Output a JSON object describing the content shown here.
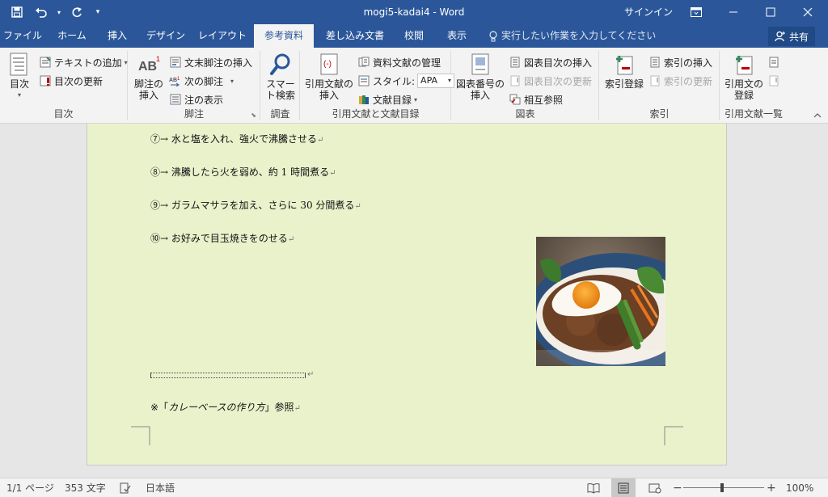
{
  "titlebar": {
    "title": "mogi5-kadai4  -  Word",
    "signin": "サインイン",
    "qat": {
      "save_icon": "save-icon",
      "undo_icon": "undo-icon",
      "redo_icon": "redo-icon",
      "customize": "▾"
    }
  },
  "tabs": [
    {
      "label": "ファイル"
    },
    {
      "label": "ホーム"
    },
    {
      "label": "挿入"
    },
    {
      "label": "デザイン"
    },
    {
      "label": "レイアウト"
    },
    {
      "label": "参考資料",
      "active": true
    },
    {
      "label": "差し込み文書"
    },
    {
      "label": "校閲"
    },
    {
      "label": "表示"
    }
  ],
  "tellme": "実行したい作業を入力してください",
  "share": "共有",
  "ribbon": {
    "toc": {
      "group_label": "目次",
      "toc_button": "目次",
      "add_text": "テキストの追加",
      "update_toc": "目次の更新"
    },
    "footnotes": {
      "group_label": "脚注",
      "insert_footnote_l1": "脚注の",
      "insert_footnote_l2": "挿入",
      "insert_endnote": "文末脚注の挿入",
      "next_footnote": "次の脚注",
      "show_notes": "注の表示"
    },
    "research": {
      "group_label": "調査",
      "smart_lookup_l1": "スマー",
      "smart_lookup_l2": "ト検索"
    },
    "citations": {
      "group_label": "引用文献と文献目録",
      "insert_citation_l1": "引用文献の",
      "insert_citation_l2": "挿入",
      "manage_sources": "資料文献の管理",
      "style_label": "スタイル:",
      "style_value": "APA",
      "bibliography": "文献目録"
    },
    "captions": {
      "group_label": "図表",
      "insert_caption_l1": "図表番号の",
      "insert_caption_l2": "挿入",
      "insert_table_of_figures": "図表目次の挿入",
      "update_table": "図表目次の更新",
      "cross_reference": "相互参照"
    },
    "index": {
      "group_label": "索引",
      "mark_entry": "索引登録",
      "insert_index": "索引の挿入",
      "update_index": "索引の更新"
    },
    "table_of_authorities": {
      "group_label": "引用文献一覧",
      "mark_citation_l1": "引用文の",
      "mark_citation_l2": "登録"
    }
  },
  "document": {
    "lines": [
      {
        "text": "⑦→ 水と塩を入れ、強火で沸騰させる",
        "mark": "↵"
      },
      {
        "text": "⑧→ 沸騰したら火を弱め、約 1 時間煮る",
        "mark": "↵"
      },
      {
        "text": "⑨→ ガラムマサラを加え、さらに 30 分間煮る",
        "mark": "↵"
      },
      {
        "text": "⑩→ お好みで目玉焼きをのせる",
        "mark": "↵"
      }
    ],
    "footnote_sep_mark": "↵",
    "footnote": {
      "prefix": "※「",
      "italic": "カレーベースの作り方",
      "suffix": "」参照",
      "mark": "↵"
    }
  },
  "statusbar": {
    "page": "1/1 ページ",
    "words": "353 文字",
    "language": "日本語",
    "zoom": "100%"
  },
  "colors": {
    "brand": "#2b579a",
    "page_background": "#eaf2cc",
    "ribbon": "#f3f3f3"
  }
}
